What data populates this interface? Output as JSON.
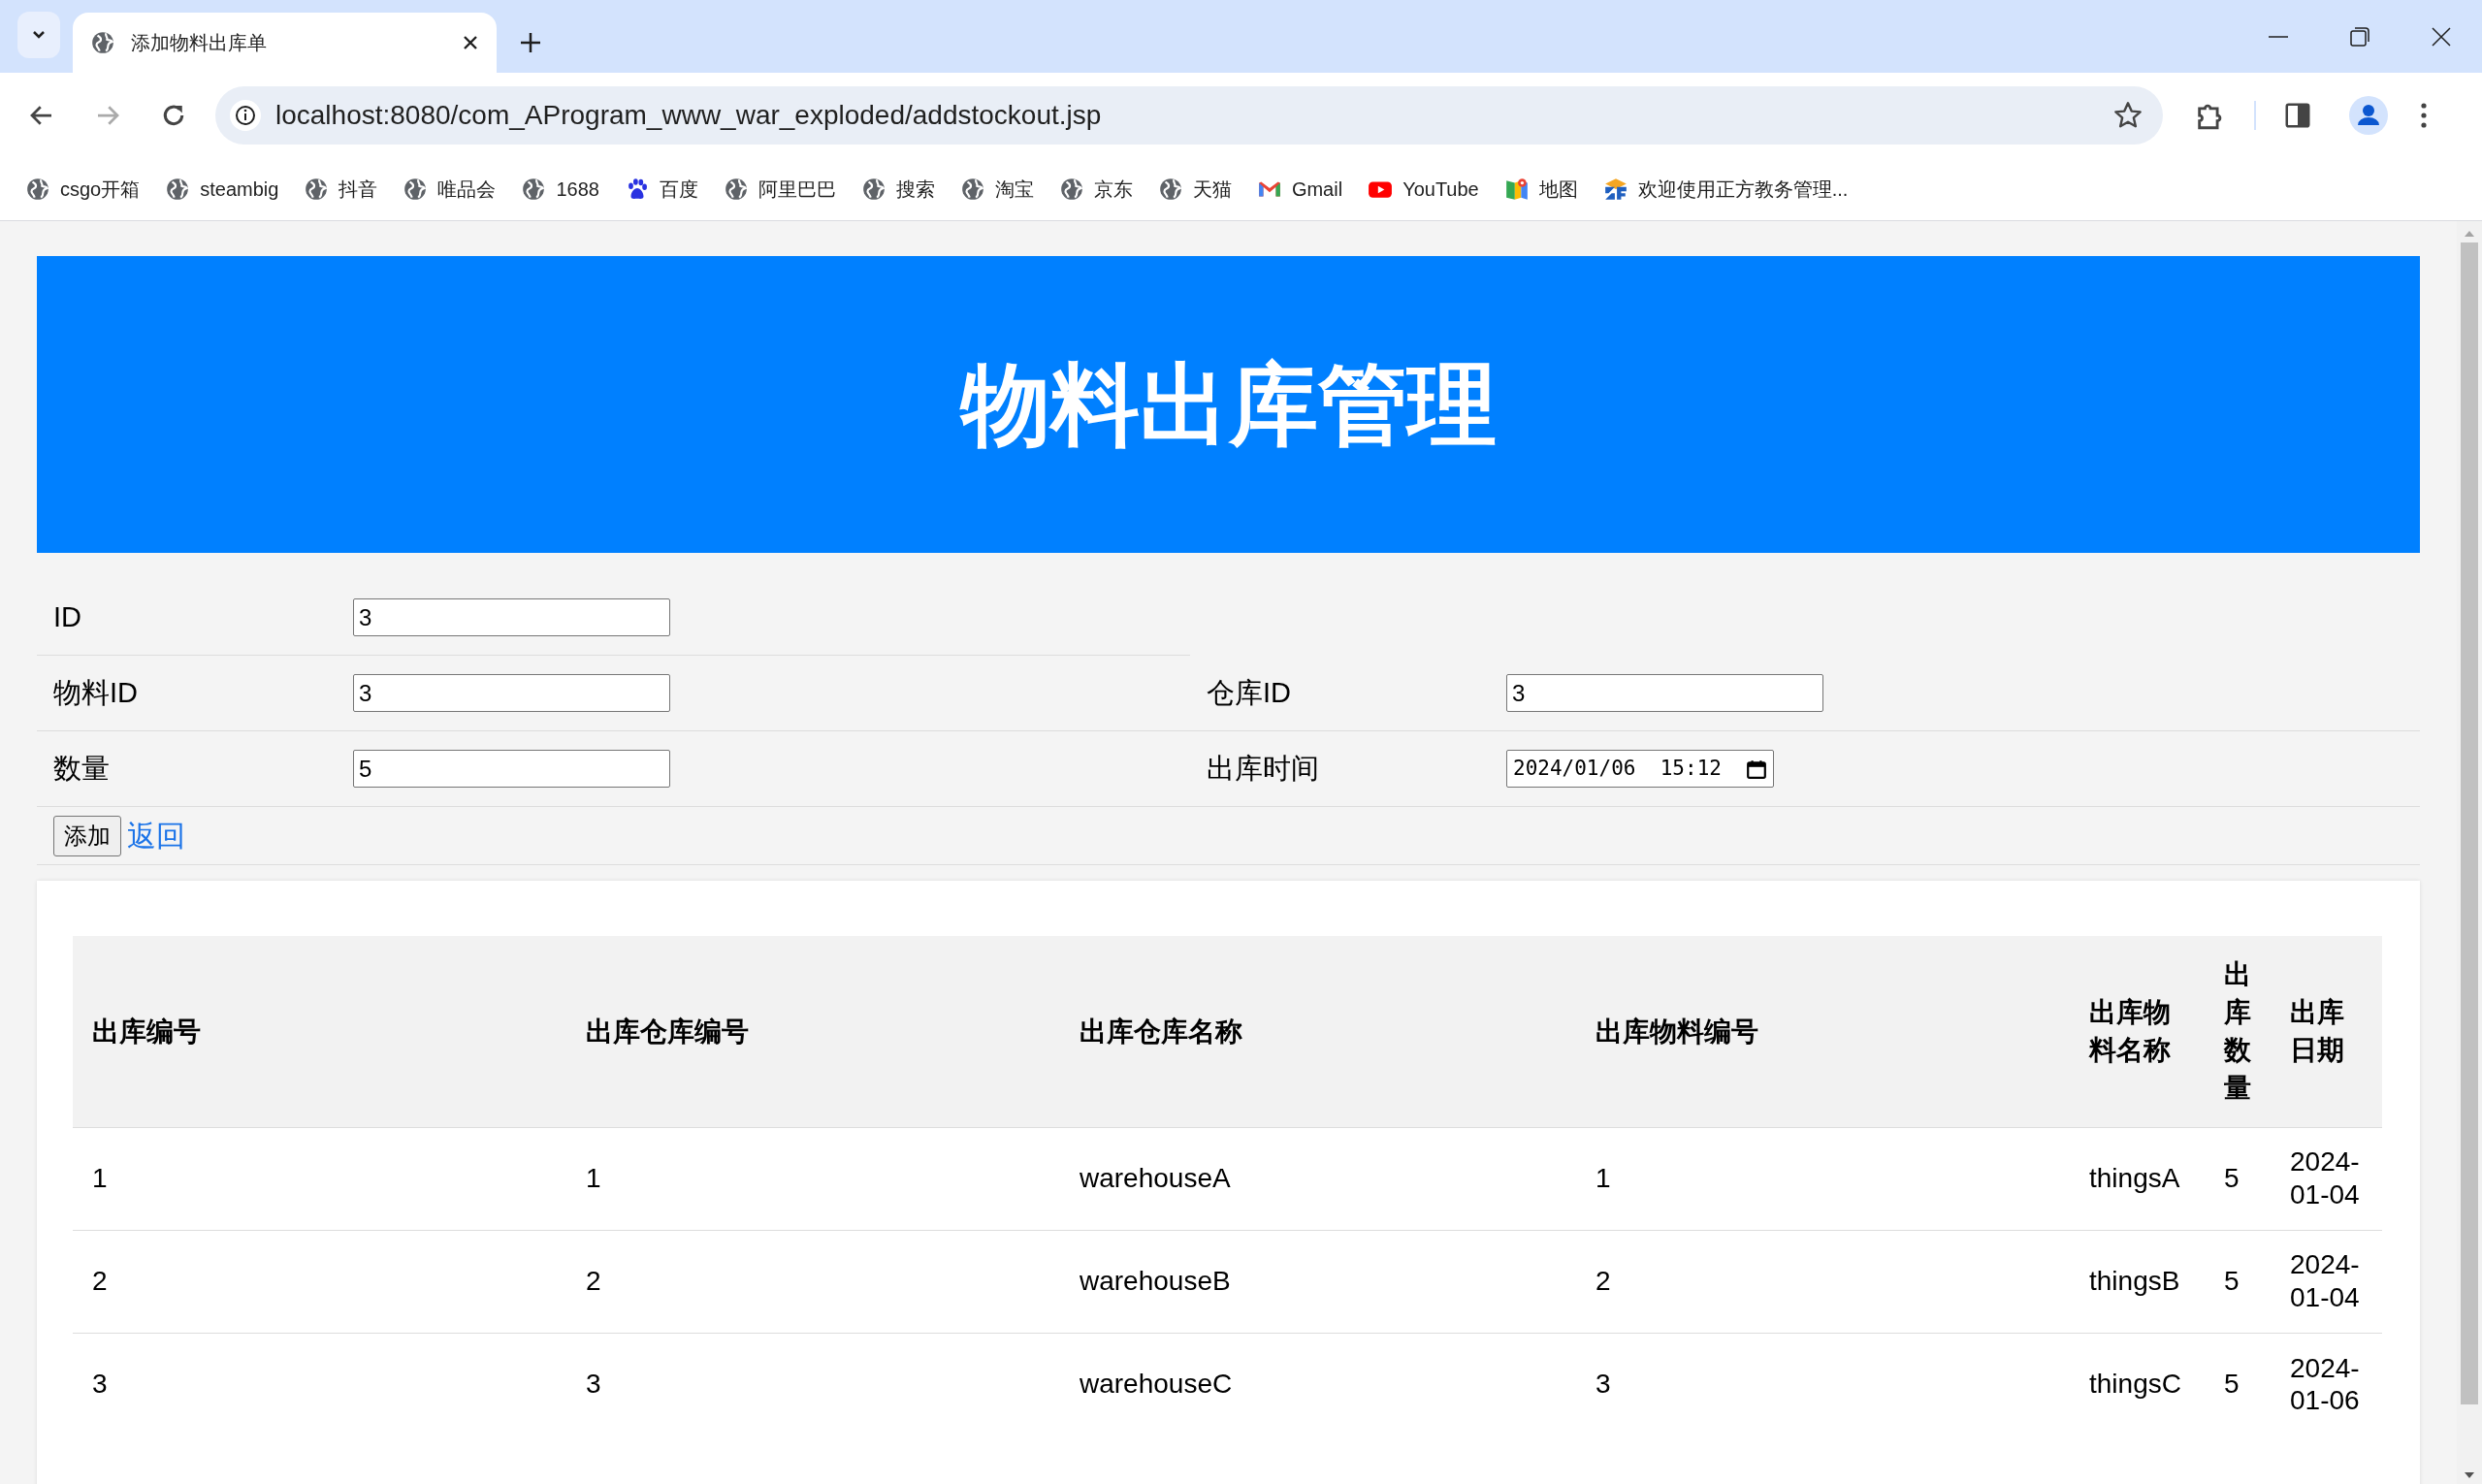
{
  "browser": {
    "tabs": [
      {
        "title": "添加物料出库单",
        "selected": true
      }
    ],
    "url": "localhost:8080/com_AProgram_www_war_exploded/addstockout.jsp",
    "bookmarks": [
      {
        "label": "csgo开箱",
        "kind": "globe"
      },
      {
        "label": "steambig",
        "kind": "globe"
      },
      {
        "label": "抖音",
        "kind": "globe"
      },
      {
        "label": "唯品会",
        "kind": "globe"
      },
      {
        "label": "1688",
        "kind": "globe"
      },
      {
        "label": "百度",
        "kind": "paw"
      },
      {
        "label": "阿里巴巴",
        "kind": "globe"
      },
      {
        "label": "搜索",
        "kind": "globe"
      },
      {
        "label": "淘宝",
        "kind": "globe"
      },
      {
        "label": "京东",
        "kind": "globe"
      },
      {
        "label": "天猫",
        "kind": "globe"
      },
      {
        "label": "Gmail",
        "kind": "mail"
      },
      {
        "label": "YouTube",
        "kind": "play"
      },
      {
        "label": "地图",
        "kind": "map"
      },
      {
        "label": "欢迎使用正方教务管理...",
        "kind": "school"
      }
    ]
  },
  "page": {
    "banner_title": "物料出库管理",
    "form": {
      "rows": [
        [
          {
            "label": "ID",
            "value": "3",
            "kind": "text"
          }
        ],
        [
          {
            "label": "物料ID",
            "value": "3",
            "kind": "text"
          },
          {
            "label": "仓库ID",
            "value": "3",
            "kind": "text"
          }
        ],
        [
          {
            "label": "数量",
            "value": "5",
            "kind": "text"
          },
          {
            "label": "出库时间",
            "value": "2024/01/06  15:12",
            "kind": "datetime"
          }
        ]
      ],
      "submit": "添加",
      "back_link": "返回"
    },
    "table": {
      "columns": [
        "出库编号",
        "出库仓库编号",
        "出库仓库名称",
        "出库物料编号",
        "出库物料名称",
        "出库数量",
        "出库日期"
      ],
      "rows": [
        [
          "1",
          "1",
          "warehouseA",
          "1",
          "thingsA",
          "5",
          "2024-01-04"
        ],
        [
          "2",
          "2",
          "warehouseB",
          "2",
          "thingsB",
          "5",
          "2024-01-04"
        ],
        [
          "3",
          "3",
          "warehouseC",
          "3",
          "thingsC",
          "5",
          "2024-01-06"
        ]
      ]
    }
  }
}
